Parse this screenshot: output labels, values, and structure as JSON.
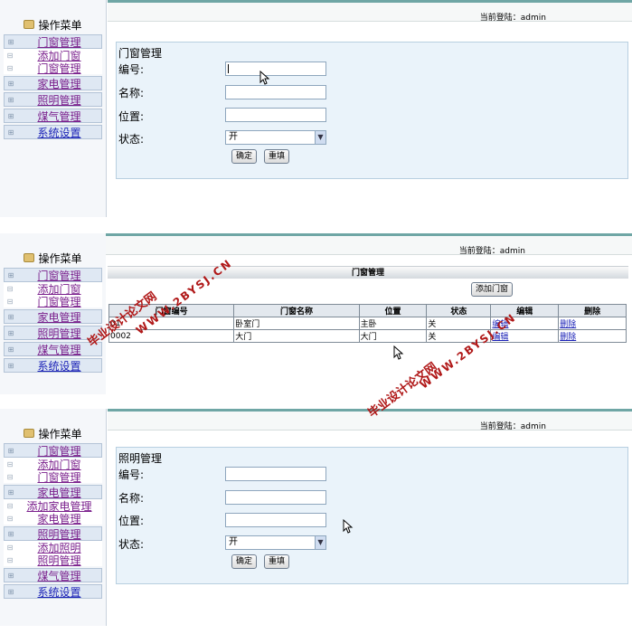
{
  "menu": {
    "title": "操作菜单",
    "items": {
      "doors": "门窗管理",
      "add_door": "添加门窗",
      "door_manage": "门窗管理",
      "appliance": "家电管理",
      "lighting": "照明管理",
      "gas": "煤气管理",
      "system": "系统设置",
      "add_appliance": "添加家电管理",
      "appliance_manage": "家电管理",
      "add_lighting": "添加照明",
      "lighting_manage": "照明管理"
    }
  },
  "login_text": "当前登陆：admin",
  "door_form": {
    "title": "门窗管理",
    "id_label": "编号:",
    "name_label": "名称:",
    "location_label": "位置:",
    "status_label": "状态:",
    "status_value": "开",
    "submit": "确定",
    "reset": "重填"
  },
  "door_list": {
    "title": "门窗管理",
    "add_button": "添加门窗",
    "columns": [
      "门窗编号",
      "门窗名称",
      "位置",
      "状态",
      "编辑",
      "删除"
    ],
    "rows": [
      {
        "id": "01",
        "name": "卧室门",
        "location": "主卧",
        "status": "关",
        "edit": "编辑",
        "delete": "删除"
      },
      {
        "id": "0002",
        "name": "大门",
        "location": "大门",
        "status": "关",
        "edit": "编辑",
        "delete": "删除"
      }
    ]
  },
  "light_form": {
    "title": "照明管理",
    "id_label": "编号:",
    "name_label": "名称:",
    "location_label": "位置:",
    "status_label": "状态:",
    "status_value": "开",
    "submit": "确定",
    "reset": "重填"
  },
  "watermark": {
    "cn": "毕业设计论文网",
    "url": "WWW.2BYSJ.CN"
  },
  "colors": {
    "accent": "#6fa6a5",
    "link": "#1c23b7",
    "visited": "#7a1f8c",
    "form_bg": "#eaf3fa",
    "watermark": "#b01818"
  }
}
